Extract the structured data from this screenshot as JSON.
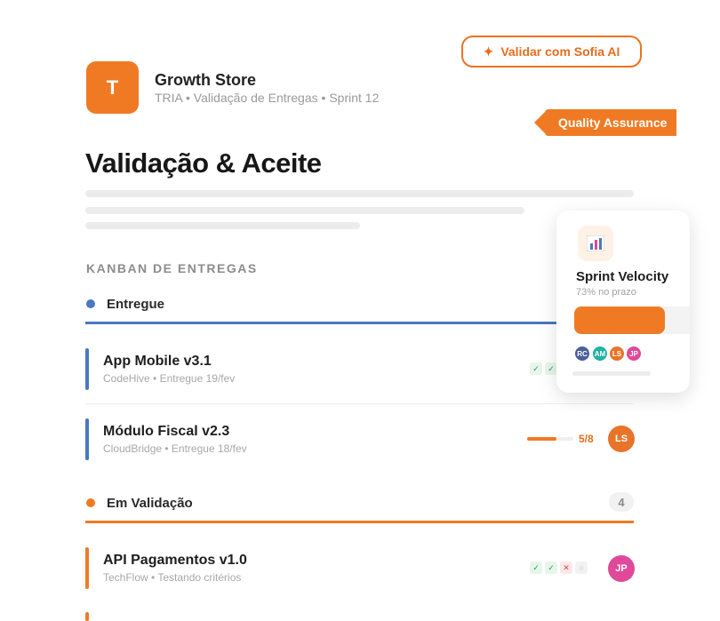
{
  "header": {
    "ai_button": {
      "icon": "sparkle-icon",
      "label": "Validar com Sofia AI"
    },
    "logo_letter": "T",
    "store_name": "Growth Store",
    "store_subtitle": "TRIA • Validação de Entregas • Sprint 12",
    "qa_tag": "Quality Assurance"
  },
  "page_title": "Validação & Aceite",
  "section_label": "KANBAN DE ENTREGAS",
  "groups": [
    {
      "title": "Entregue",
      "color": "#4a78c2",
      "items": [
        {
          "title": "App Mobile v3.1",
          "subtitle": "CodeHive • Entregue 19/fev",
          "checks": [
            "ok",
            "ok"
          ]
        },
        {
          "title": "Módulo Fiscal v2.3",
          "subtitle": "CloudBridge • Entregue 18/fev",
          "progress": {
            "done": 5,
            "total": 8,
            "label": "5/8"
          },
          "assignee": "LS"
        }
      ]
    },
    {
      "title": "Em Validação",
      "color": "#f07a24",
      "count": "4",
      "items": [
        {
          "title": "API Pagamentos v1.0",
          "subtitle": "TechFlow • Testando critérios",
          "checks": [
            "ok",
            "ok",
            "fail",
            "pending"
          ],
          "assignee": "JP"
        }
      ]
    }
  ],
  "velocity_card": {
    "icon": "bar-chart-icon",
    "title": "Sprint Velocity",
    "subtitle": "73% no prazo",
    "progress_percent": 73,
    "team": [
      "RC",
      "AM",
      "LS",
      "JP"
    ]
  },
  "colors": {
    "accent": "#f07a24",
    "blue": "#4a78c2",
    "avatar_LS": "#e8742a",
    "avatar_JP": "#e0489a",
    "avatar_RC": "#4a5f9c",
    "avatar_AM": "#1fb3a0"
  }
}
